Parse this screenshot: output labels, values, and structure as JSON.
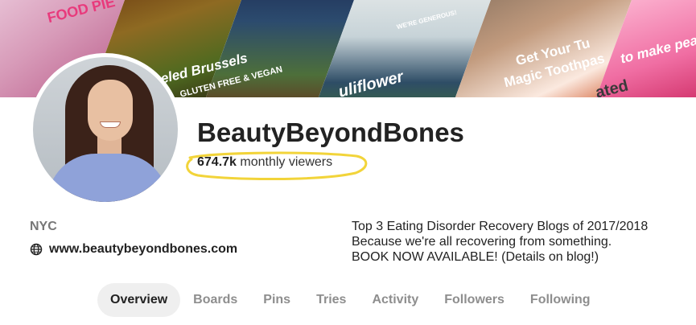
{
  "cover": {
    "texts": [
      "FOOD PIE",
      "Peeled Brussels",
      "GLUTEN FREE & VEGAN",
      "uliflower",
      "WE'RE GENEROUS!",
      "Get Your Tu",
      "Magic Toothpas",
      "to make pea",
      "ated"
    ]
  },
  "profile": {
    "name": "BeautyBeyondBones",
    "viewers_count": "674.7k",
    "viewers_label": "monthly viewers",
    "location": "NYC",
    "website": "www.beautybeyondbones.com",
    "bio": [
      "Top 3 Eating Disorder Recovery Blogs of 2017/2018",
      "Because we're all recovering from something.",
      "BOOK NOW AVAILABLE! (Details on blog!)"
    ]
  },
  "tabs": [
    "Overview",
    "Boards",
    "Pins",
    "Tries",
    "Activity",
    "Followers",
    "Following"
  ],
  "active_tab": "Overview",
  "colors": {
    "highlight": "#f2d43a",
    "active_tab_bg": "#efefef",
    "inactive_tab_text": "#8e8e8e"
  },
  "icons": {
    "website": "globe-icon"
  }
}
